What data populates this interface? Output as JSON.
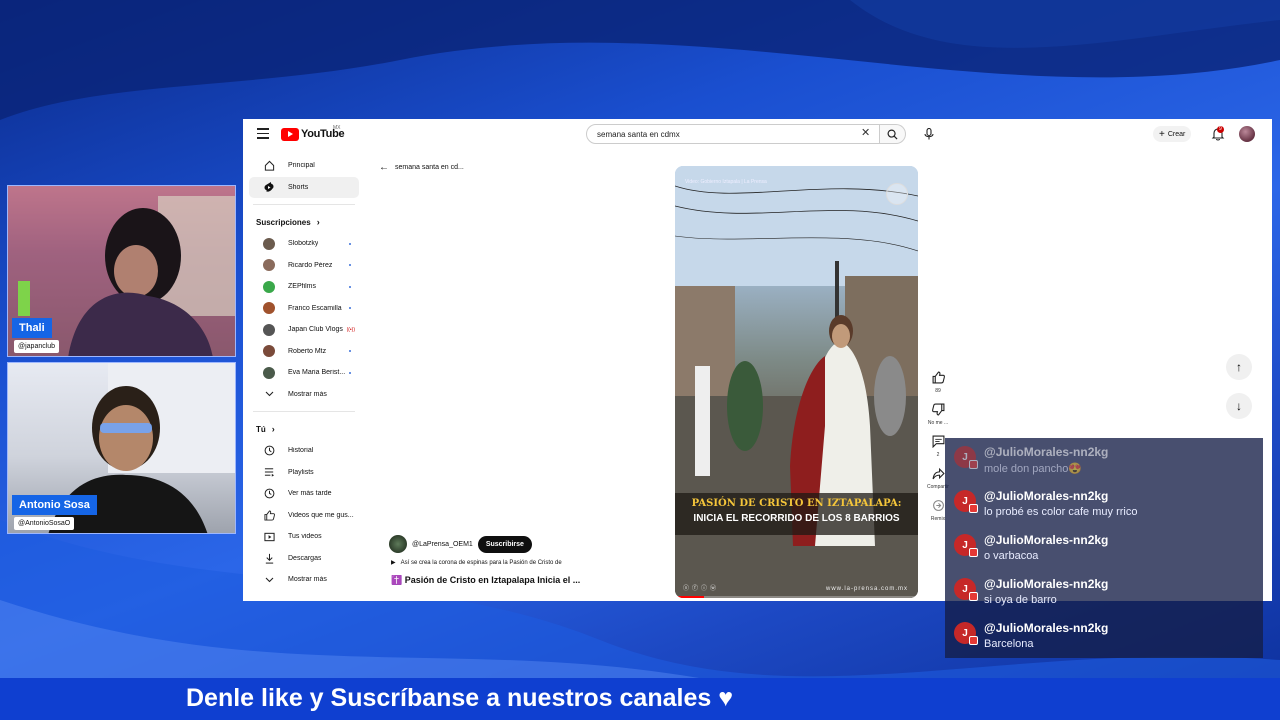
{
  "cams": [
    {
      "name": "Thali",
      "handle": "@japanclub"
    },
    {
      "name": "Antonio Sosa",
      "handle": "@AntonioSosaO"
    }
  ],
  "youtube": {
    "logo_text": "YouTube",
    "country": "MX",
    "search_value": "semana santa en cdmx",
    "create_label": "Crear",
    "notif_count": "9",
    "back_text": "semana santa en cd...",
    "sidebar": {
      "main": [
        {
          "label": "Principal",
          "icon": "home-icon"
        },
        {
          "label": "Shorts",
          "icon": "shorts-icon"
        }
      ],
      "subs_heading": "Suscripciones",
      "subs": [
        {
          "label": "Slobotzky",
          "color": "#6b5b4e"
        },
        {
          "label": "Ricardo Pérez",
          "color": "#8a6b5c"
        },
        {
          "label": "ZEPfilms",
          "color": "#3aa84a"
        },
        {
          "label": "Franco Escamilla",
          "color": "#a0522d"
        },
        {
          "label": "Japan Club Vlogs",
          "color": "#555555"
        },
        {
          "label": "Roberto Mtz",
          "color": "#7a4a3a"
        },
        {
          "label": "Eva Maria Berist...",
          "color": "#4a5a4a"
        }
      ],
      "more_label": "Mostrar más",
      "you_heading": "Tú",
      "you": [
        {
          "label": "Historial",
          "icon": "history-icon"
        },
        {
          "label": "Playlists",
          "icon": "playlist-icon"
        },
        {
          "label": "Ver más tarde",
          "icon": "clock-icon"
        },
        {
          "label": "Videos que me gus...",
          "icon": "like-icon"
        },
        {
          "label": "Tus videos",
          "icon": "video-icon"
        },
        {
          "label": "Descargas",
          "icon": "download-icon"
        }
      ],
      "more_label2": "Mostrar más"
    },
    "video": {
      "credit": "Video: Gobierno Iztapala | La Prensa",
      "caption_line1": "PASIÓN DE CRISTO EN IZTAPALAPA:",
      "caption_line2": "INICIA EL RECORRIDO DE LOS 8 BARRIOS",
      "url": "www.la-prensa.com.mx",
      "progress": 0.12
    },
    "channel": "@LaPrensa_OEM1",
    "subscribe_label": "Suscribirse",
    "desc": "Así se crea la corona de espinas para la Pasión de Cristo de",
    "title": "✝️ Pasión de Cristo en Iztapalapa Inicia el ...",
    "actions": [
      {
        "label": "89",
        "icon": "thumbs-up-icon"
      },
      {
        "label": "No me ...",
        "icon": "thumbs-down-icon"
      },
      {
        "label": "2",
        "icon": "comment-icon"
      },
      {
        "label": "Compartir",
        "icon": "share-icon"
      },
      {
        "label": "Remix",
        "icon": "remix-icon"
      }
    ]
  },
  "chat": [
    {
      "user": "@JulioMorales-nn2kg",
      "text": "mole don pancho😍",
      "faded": true
    },
    {
      "user": "@JulioMorales-nn2kg",
      "text": "lo probé es color cafe muy rrico",
      "faded": false
    },
    {
      "user": "@JulioMorales-nn2kg",
      "text": "o varbacoa",
      "faded": false
    },
    {
      "user": "@JulioMorales-nn2kg",
      "text": "si oya de barro",
      "faded": false
    },
    {
      "user": "@JulioMorales-nn2kg",
      "text": "Barcelona",
      "faded": false
    }
  ],
  "banner_text": "Denle like y Suscríbanse a nuestros canales ♥"
}
